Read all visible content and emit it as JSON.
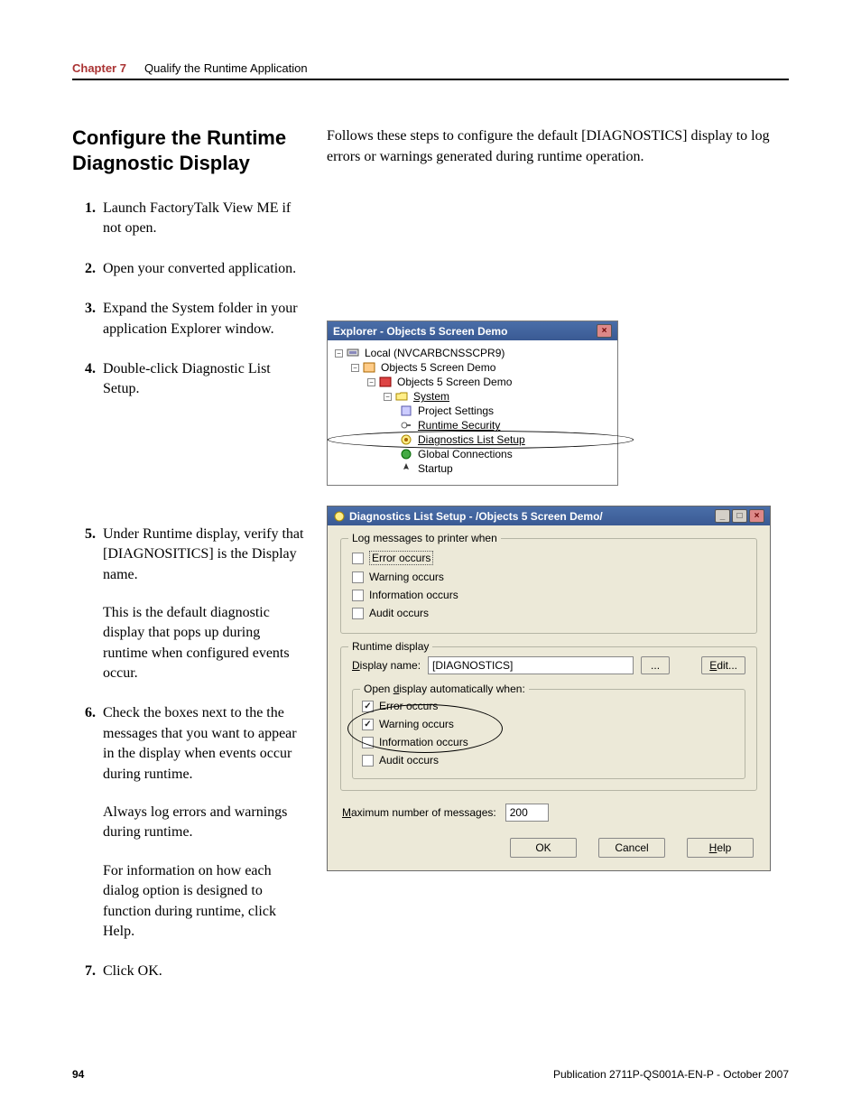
{
  "header": {
    "chapter_label": "Chapter 7",
    "chapter_title": "Qualify the Runtime Application"
  },
  "heading": "Configure the Runtime Diagnostic Display",
  "intro": "Follows these steps to configure the default [DIAGNOSTICS] display to log errors or warnings generated during runtime operation.",
  "steps": {
    "s1": "Launch FactoryTalk View ME if not open.",
    "s2": "Open your converted application.",
    "s3": "Expand the System folder in your application Explorer window.",
    "s4": "Double-click Diagnostic List Setup.",
    "s5": "Under Runtime display, verify that [DIAGNOSITICS] is the Display name.",
    "s5_note1": "This is the default diagnostic display that pops up during runtime when configured events occur.",
    "s6": "Check the boxes next to the the messages that you want to appear in the display when events occur during runtime.",
    "s6_note1": "Always log errors and warnings during runtime.",
    "s6_note2": "For information on how each dialog option is designed to function during runtime, click Help.",
    "s7": "Click OK."
  },
  "explorer": {
    "title": "Explorer - Objects 5 Screen Demo",
    "n0": "Local (NVCARBCNSSCPR9)",
    "n1": "Objects 5 Screen Demo",
    "n2": "Objects 5 Screen Demo",
    "n3": "System",
    "n4": "Project Settings",
    "n5": "Runtime Security",
    "n6": "Diagnostics List Setup",
    "n7": "Global Connections",
    "n8": "Startup"
  },
  "dialog": {
    "title": "Diagnostics List Setup - /Objects 5 Screen Demo/",
    "group1_legend": "Log messages to printer when",
    "opt_error": "Error occurs",
    "opt_warning": "Warning occurs",
    "opt_info": "Information occurs",
    "opt_audit": "Audit occurs",
    "group2_legend": "Runtime display",
    "display_label_pre": "D",
    "display_label_post": "isplay name:",
    "display_value": "[DIAGNOSTICS]",
    "browse_btn": "...",
    "edit_pre": "E",
    "edit_post": "dit...",
    "inner_legend_pre": "Open ",
    "inner_legend_u": "d",
    "inner_legend_post": "isplay automatically when:",
    "max_label_pre": "M",
    "max_label_post": "aximum number of messages:",
    "max_value": "200",
    "ok": "OK",
    "cancel": "Cancel",
    "help_pre": "H",
    "help_post": "elp"
  },
  "footer": {
    "page": "94",
    "pub": "Publication 2711P-QS001A-EN-P - October 2007"
  }
}
